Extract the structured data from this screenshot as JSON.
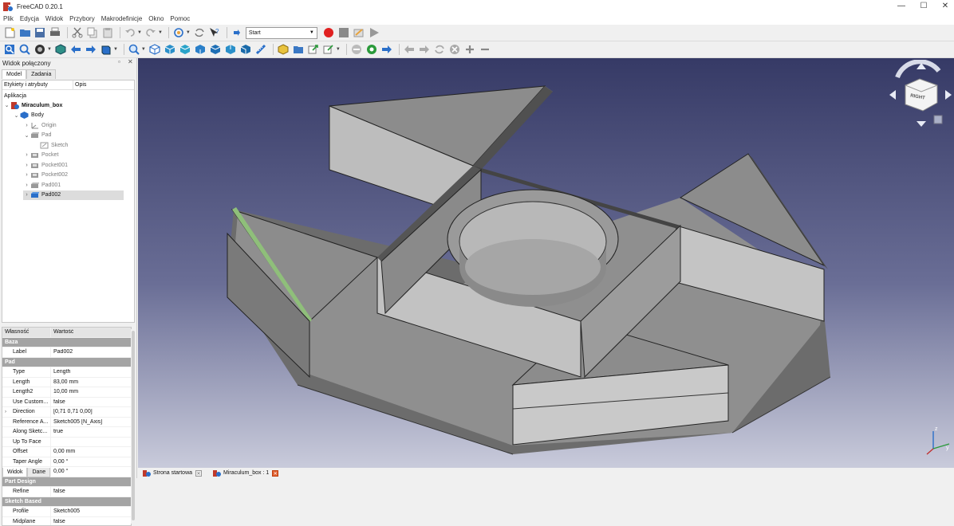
{
  "window": {
    "title": "FreeCAD 0.20.1",
    "minimize": "—",
    "maximize": "☐",
    "close": "✕"
  },
  "menu": [
    "Plik",
    "Edycja",
    "Widok",
    "Przybory",
    "Makrodefinicje",
    "Okno",
    "Pomoc"
  ],
  "toolbar": {
    "workbench": "Start"
  },
  "combo_view": {
    "title": "Widok połączony",
    "tabs": [
      "Model",
      "Zadania"
    ],
    "tree_columns": [
      "Etykiety i atrybuty",
      "Opis"
    ],
    "section": "Aplikacja",
    "tree": [
      {
        "label": "Miraculum_box",
        "bold": true
      },
      {
        "label": "Body",
        "bold": false
      },
      {
        "label": "Origin",
        "dim": true
      },
      {
        "label": "Pad",
        "dim": true
      },
      {
        "label": "Sketch",
        "dim": true
      },
      {
        "label": "Pocket",
        "dim": true
      },
      {
        "label": "Pocket001",
        "dim": true
      },
      {
        "label": "Pocket002",
        "dim": true
      },
      {
        "label": "Pad001",
        "dim": true
      },
      {
        "label": "Pad002",
        "selected": true
      }
    ]
  },
  "properties": {
    "headers": [
      "Własność",
      "Wartość"
    ],
    "rows": [
      {
        "group": "Baza"
      },
      {
        "key": "Label",
        "value": "Pad002"
      },
      {
        "group": "Pad"
      },
      {
        "key": "Type",
        "value": "Length"
      },
      {
        "key": "Length",
        "value": "83,00 mm"
      },
      {
        "key": "Length2",
        "value": "10,00 mm"
      },
      {
        "key": "Use Custom...",
        "value": "false"
      },
      {
        "key": "Direction",
        "value": "[0,71 0,71 0,00]",
        "expandable": true
      },
      {
        "key": "Reference A...",
        "value": "Sketch005 [N_Axis]"
      },
      {
        "key": "Along Sketc...",
        "value": "true"
      },
      {
        "key": "Up To Face",
        "value": ""
      },
      {
        "key": "Offset",
        "value": "0,00 mm"
      },
      {
        "key": "Taper Angle",
        "value": "0,00 °"
      },
      {
        "key": "Taper Angle2",
        "value": "0,00 °"
      },
      {
        "group": "Part Design"
      },
      {
        "key": "Refine",
        "value": "false"
      },
      {
        "group": "Sketch Based"
      },
      {
        "key": "Profile",
        "value": "Sketch005"
      },
      {
        "key": "Midplane",
        "value": "false"
      }
    ]
  },
  "panel_tabs": [
    "Widok",
    "Dane"
  ],
  "document_tabs": [
    {
      "label": "Strona startowa",
      "active": false
    },
    {
      "label": "Miraculum_box : 1",
      "active": true
    }
  ],
  "navcube": {
    "face": "RIGHT"
  },
  "axis": {
    "z": "z",
    "y": "y"
  },
  "colors": {
    "record": "#e02020",
    "stop": "#8a8a8a",
    "accent": "#2a6fc9",
    "selected_edge": "#8fbf7a"
  }
}
